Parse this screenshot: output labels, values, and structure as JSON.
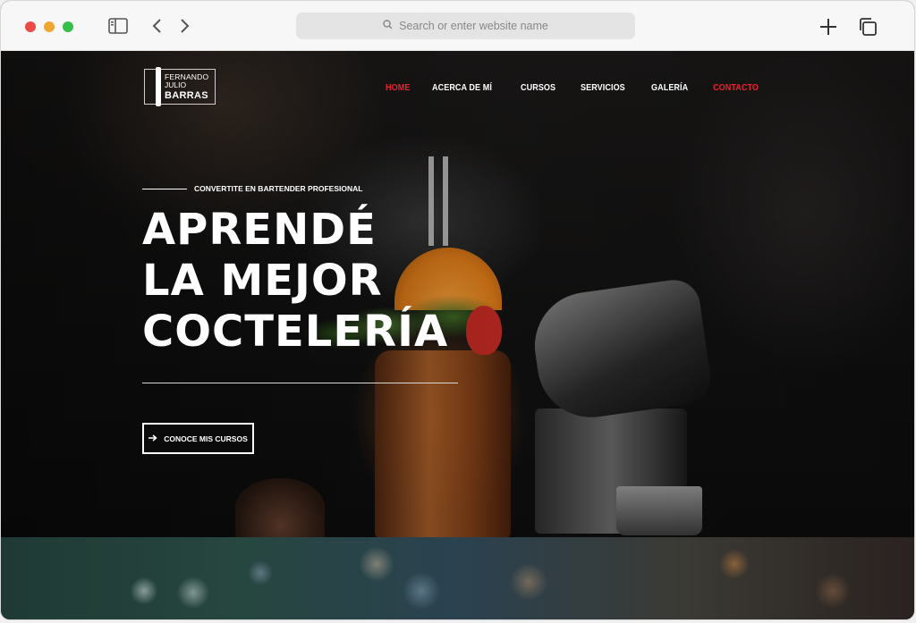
{
  "browser": {
    "address_placeholder": "Search or enter website name"
  },
  "logo": {
    "line1": "FERNANDO",
    "line2": "JULIO",
    "line3": "BARRAS"
  },
  "nav": {
    "items": [
      {
        "label": "HOME",
        "state": "active"
      },
      {
        "label": "ACERCA DE MÍ",
        "state": ""
      },
      {
        "label": "CURSOS",
        "state": ""
      },
      {
        "label": "SERVICIOS",
        "state": ""
      },
      {
        "label": "GALERÍA",
        "state": ""
      },
      {
        "label": "CONTACTO",
        "state": "accent"
      }
    ],
    "accent_color": "#e8222e"
  },
  "hero": {
    "eyebrow": "CONVERTITE EN BARTENDER PROFESIONAL",
    "headline": [
      "APRENDÉ",
      "LA MEJOR",
      "COCTELERÍA"
    ],
    "cta_label": "CONOCE MIS CURSOS",
    "cta_icon": "arrow-right-icon"
  }
}
